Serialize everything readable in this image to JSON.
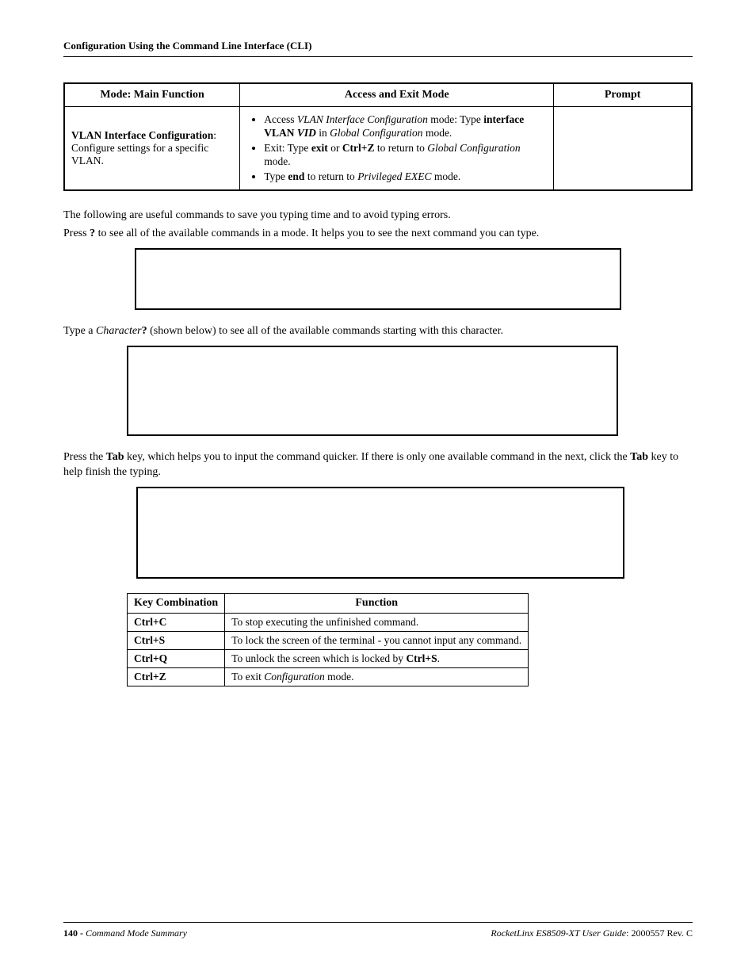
{
  "header": {
    "title": "Configuration Using the Command Line Interface (CLI)"
  },
  "mainTable": {
    "headers": {
      "mode": "Mode: Main Function",
      "access": "Access and Exit Mode",
      "prompt": "Prompt"
    },
    "row": {
      "modeTitle": "VLAN Interface Configuration",
      "modeDesc": ": Configure settings for a specific VLAN.",
      "b1_pre": "Access ",
      "b1_i1": "VLAN Interface Configuration",
      "b1_mid": " mode: Type ",
      "b1_b1": "interface VLAN ",
      "b1_bi1": "VID",
      "b1_mid2": " in ",
      "b1_i2": "Global Configuration",
      "b1_end": " mode.",
      "b2_pre": "Exit: Type ",
      "b2_b1": "exit",
      "b2_mid1": " or ",
      "b2_b2": "Ctrl+Z",
      "b2_mid2": " to return to ",
      "b2_i1": "Global Configuration",
      "b2_end": " mode.",
      "b3_pre": "Type ",
      "b3_b1": "end",
      "b3_mid": " to return to ",
      "b3_i1": "Privileged EXEC",
      "b3_end": " mode.",
      "prompt": ""
    }
  },
  "paras": {
    "p1": "The following are useful commands to save you typing time and to avoid typing errors.",
    "p2_pre": "Press ",
    "p2_b": "?",
    "p2_post": " to see all of the available commands in a mode. It helps you to see the next command you can type.",
    "p3_pre": "Type a ",
    "p3_i": "Character",
    "p3_b": "?",
    "p3_post": " (shown below) to see all of the available commands starting with this character.",
    "p4_pre": "Press the ",
    "p4_b1": "Tab",
    "p4_mid": " key, which helps you to input the command quicker. If there is only one available command in the next, click the ",
    "p4_b2": "Tab",
    "p4_post": " key to help finish the typing."
  },
  "keyTable": {
    "headers": {
      "combo": "Key Combination",
      "func": "Function"
    },
    "rows": [
      {
        "combo": "Ctrl+C",
        "func": "To stop executing the unfinished command."
      },
      {
        "combo": "Ctrl+S",
        "func": "To lock the screen of the terminal - you cannot input any command."
      },
      {
        "combo": "Ctrl+Q",
        "func_pre": "To unlock the screen which is locked by ",
        "func_b": "Ctrl+S",
        "func_post": "."
      },
      {
        "combo": "Ctrl+Z",
        "func_pre": "To exit ",
        "func_i": "Configuration",
        "func_post": " mode."
      }
    ]
  },
  "footer": {
    "pageNum": "140 - ",
    "leftItalic": "Command Mode Summary",
    "rightItalic": "RocketLinx ES8509-XT User Guide",
    "rightRest": ": 2000557 Rev. C"
  }
}
